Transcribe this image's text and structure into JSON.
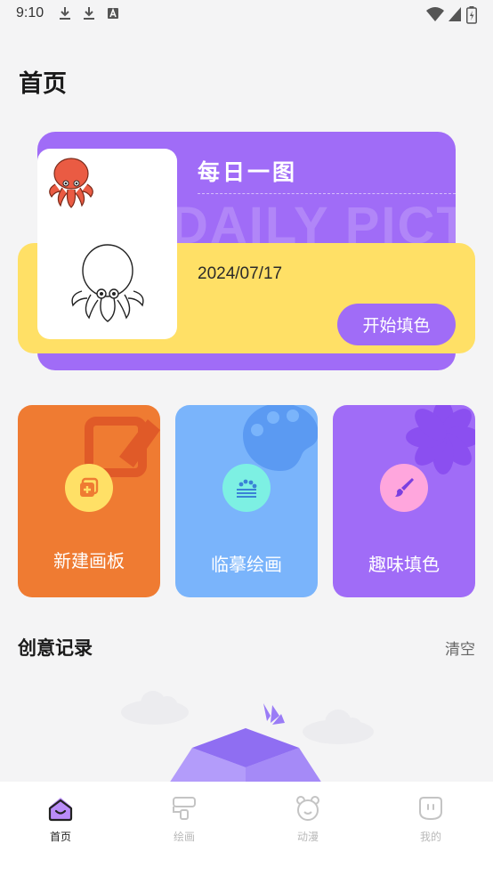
{
  "status_bar": {
    "time": "9:10",
    "left_icons": [
      "download-icon",
      "download-icon",
      "keyboard-a-icon"
    ],
    "right_icons": [
      "wifi-icon",
      "signal-icon",
      "battery-icon"
    ]
  },
  "header": {
    "title": "首页"
  },
  "daily_picture": {
    "title": "每日一图",
    "background_text": "DAILY PICTURE",
    "date": "2024/07/17",
    "start_button": "开始填色",
    "colors": {
      "back": "#a06cf7",
      "front": "#ffe066"
    }
  },
  "feature_cards": [
    {
      "label": "新建画板",
      "icon": "new-canvas-icon",
      "color": "#ef7b32",
      "icon_bg": "#ffe066"
    },
    {
      "label": "临摹绘画",
      "icon": "palette-icon",
      "color": "#7ab4fb",
      "icon_bg": "#7df0e3"
    },
    {
      "label": "趣味填色",
      "icon": "paint-brush-icon",
      "color": "#a06cf7",
      "icon_bg": "#ffa6dd"
    }
  ],
  "creative_records": {
    "title": "创意记录",
    "clear": "清空"
  },
  "bottom_nav": {
    "items": [
      {
        "label": "首页",
        "icon": "home-icon",
        "active": true
      },
      {
        "label": "绘画",
        "icon": "paint-roller-icon",
        "active": false
      },
      {
        "label": "动漫",
        "icon": "bear-face-icon",
        "active": false
      },
      {
        "label": "我的",
        "icon": "profile-icon",
        "active": false
      }
    ]
  }
}
